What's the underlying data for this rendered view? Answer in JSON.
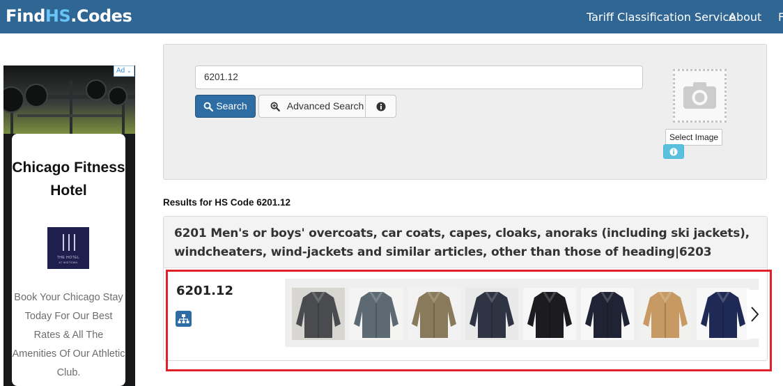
{
  "header": {
    "logo": {
      "part1": "Find",
      "part2": "HS",
      "part3": ".Codes"
    },
    "nav": [
      "Tariff Classification Service",
      "About",
      "F"
    ]
  },
  "ad": {
    "badge": "Ad",
    "title": "Chicago Fitness Hotel",
    "logo_text": "THE HOTEL",
    "logo_subtext": "AT MIDTOWN",
    "body": "Book Your Chicago Stay Today For Our Best Rates & All The Amenities Of Our Athletic Club."
  },
  "search": {
    "query": "6201.12",
    "search_label": "Search",
    "advanced_label": "Advanced Search",
    "select_image_label": "Select Image"
  },
  "results": {
    "label": "Results for HS Code 6201.12",
    "heading": "6201 Men's or boys' overcoats, car coats, capes, cloaks, anoraks (including ski jackets), windcheaters, wind-jackets and similar articles, other than those of heading|6203",
    "code": "6201.12",
    "thumbnails": [
      {
        "color": "#4a4b4f",
        "bg": "#d8d6d0"
      },
      {
        "color": "#5d6a74",
        "bg": "#f4f4f2"
      },
      {
        "color": "#8a7a5c",
        "bg": "#f2f2f2"
      },
      {
        "color": "#2f3444",
        "bg": "#e9e9e9"
      },
      {
        "color": "#1c1c20",
        "bg": "#f6f6f6"
      },
      {
        "color": "#1f2334",
        "bg": "#f7f7f7"
      },
      {
        "color": "#c69a62",
        "bg": "#f1f1ef"
      },
      {
        "color": "#1e2a55",
        "bg": "#f8f8f8"
      }
    ]
  },
  "colors": {
    "header": "#2f6693",
    "primary": "#2e6da4",
    "info": "#5bc0de",
    "highlight": "#e0202a"
  }
}
